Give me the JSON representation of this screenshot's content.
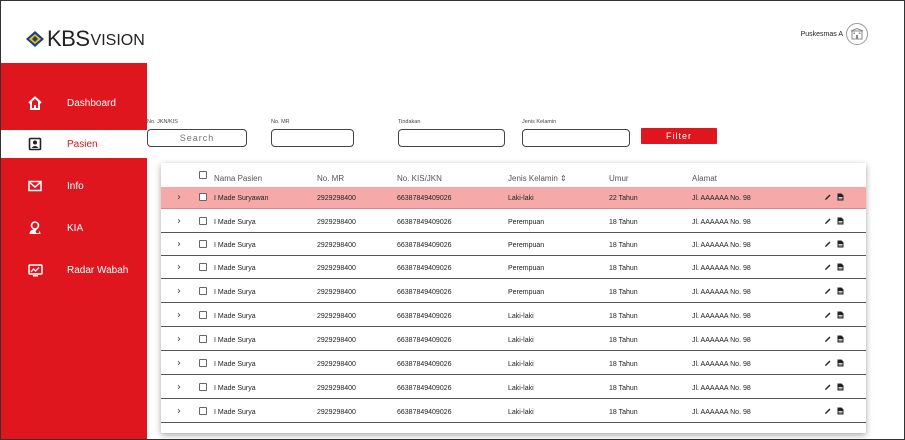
{
  "brand": {
    "logo_text": "KBS",
    "logo_suffix": "VISION"
  },
  "user": {
    "name": "Puskesmas A"
  },
  "colors": {
    "accent": "#e0161f",
    "highlight_row": "#f6a9a9"
  },
  "sidebar": {
    "items": [
      {
        "label": "Dashboard",
        "icon": "home-icon",
        "active": false
      },
      {
        "label": "Pasien",
        "icon": "patient-card-icon",
        "active": true
      },
      {
        "label": "Info",
        "icon": "mail-icon",
        "active": false
      },
      {
        "label": "KIA",
        "icon": "mother-child-icon",
        "active": false
      },
      {
        "label": "Radar Wabah",
        "icon": "radar-icon",
        "active": false
      }
    ]
  },
  "filters": {
    "jkn": {
      "label": "No. JKN/KIS",
      "placeholder": "Search"
    },
    "mr": {
      "label": "No. MR",
      "placeholder": ""
    },
    "tindakan": {
      "label": "Tindakan",
      "placeholder": ""
    },
    "jenis_kelamin": {
      "label": "Jenis Kelamin",
      "placeholder": ""
    },
    "button_label": "Filter"
  },
  "table": {
    "headers": {
      "nama": "Nama Pasien",
      "mr": "No. MR",
      "kis": "No. KIS/JKN",
      "jk": "Jenis Kelamin ⇕",
      "umur": "Umur",
      "alamat": "Alamat"
    },
    "rows": [
      {
        "nama": "I Made Suryawan",
        "mr": "2929298400",
        "kis": "66387849409026",
        "jk": "Laki-laki",
        "umur": "22 Tahun",
        "alamat": "Jl. AAAAAA No. 98"
      },
      {
        "nama": "I Made Surya",
        "mr": "2929298400",
        "kis": "66387849409026",
        "jk": "Perempuan",
        "umur": "18 Tahun",
        "alamat": "Jl. AAAAAA No. 98"
      },
      {
        "nama": "I Made Surya",
        "mr": "2929298400",
        "kis": "66387849409026",
        "jk": "Perempuan",
        "umur": "18 Tahun",
        "alamat": "Jl. AAAAAA No. 98"
      },
      {
        "nama": "I Made Surya",
        "mr": "2929298400",
        "kis": "66387849409026",
        "jk": "Perempuan",
        "umur": "18 Tahun",
        "alamat": "Jl. AAAAAA No. 98"
      },
      {
        "nama": "I Made Surya",
        "mr": "2929298400",
        "kis": "66387849409026",
        "jk": "Perempuan",
        "umur": "18 Tahun",
        "alamat": "Jl. AAAAAA No. 98"
      },
      {
        "nama": "I Made Surya",
        "mr": "2929298400",
        "kis": "66387849409026",
        "jk": "Laki-laki",
        "umur": "18 Tahun",
        "alamat": "Jl. AAAAAA No. 98"
      },
      {
        "nama": "I Made Surya",
        "mr": "2929298400",
        "kis": "66387849409026",
        "jk": "Laki-laki",
        "umur": "18 Tahun",
        "alamat": "Jl. AAAAAA No. 98"
      },
      {
        "nama": "I Made Surya",
        "mr": "2929298400",
        "kis": "66387849409026",
        "jk": "Laki-laki",
        "umur": "18 Tahun",
        "alamat": "Jl. AAAAAA No. 98"
      },
      {
        "nama": "I Made Surya",
        "mr": "2929298400",
        "kis": "66387849409026",
        "jk": "Laki-laki",
        "umur": "18 Tahun",
        "alamat": "Jl. AAAAAA No. 98"
      },
      {
        "nama": "I Made Surya",
        "mr": "2929298400",
        "kis": "66387849409026",
        "jk": "Laki-laki",
        "umur": "18 Tahun",
        "alamat": "Jl. AAAAAA No. 98"
      }
    ]
  }
}
